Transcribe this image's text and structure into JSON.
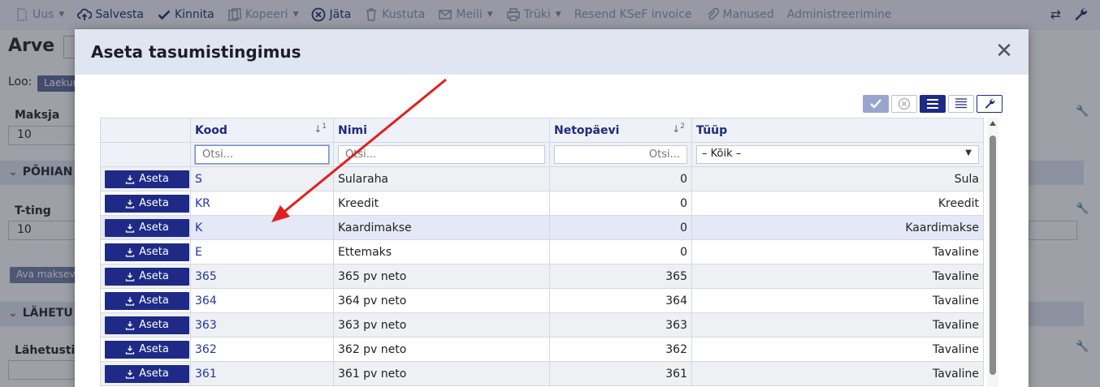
{
  "toolbar": {
    "items": [
      {
        "label": "Uus",
        "icon": "new-document-icon",
        "caret": true
      },
      {
        "label": "Salvesta",
        "icon": "cloud-upload-icon"
      },
      {
        "label": "Kinnita",
        "icon": "check-icon"
      },
      {
        "label": "Kopeeri",
        "icon": "copy-icon",
        "caret": true
      },
      {
        "label": "Jäta",
        "icon": "circle-x-icon"
      },
      {
        "label": "Kustuta",
        "icon": "trash-icon"
      },
      {
        "label": "Meili",
        "icon": "envelope-icon",
        "caret": true
      },
      {
        "label": "Trüki",
        "icon": "printer-icon",
        "caret": true
      },
      {
        "label": "Resend KSeF invoice"
      },
      {
        "label": "Manused",
        "icon": "paperclip-icon"
      },
      {
        "label": "Administreerimine"
      }
    ]
  },
  "page": {
    "title": "Arve",
    "loo_label": "Loo:",
    "loo_chip": "Laekum",
    "maksja_label": "Maksja",
    "maksja_value": "10",
    "section1": "PÕHIAN",
    "tting_label": "T-ting",
    "tting_value": "10",
    "ava_button": "Ava maksev",
    "section2": "LÄHETU",
    "lahetustin_label": "Lähetustin"
  },
  "modal": {
    "title": "Aseta tasumistingimus",
    "close_symbol": "✕",
    "columns": {
      "kood": "Kood",
      "kood_sort": "↓",
      "kood_sort_rank": "1",
      "nimi": "Nimi",
      "netopaevi": "Netopäevi",
      "netopaevi_sort": "↓",
      "netopaevi_sort_rank": "2",
      "tyyp": "Tüüp"
    },
    "filters": {
      "kood_placeholder": "Otsi...",
      "nimi_placeholder": "Otsi...",
      "netopaevi_placeholder": "Otsi...",
      "tyyp_selected": "– Kõik –"
    },
    "action_label": "Aseta",
    "rows": [
      {
        "kood": "S",
        "nimi": "Sularaha",
        "netopaevi": "0",
        "tyyp": "Sula"
      },
      {
        "kood": "KR",
        "nimi": "Kreedit",
        "netopaevi": "0",
        "tyyp": "Kreedit"
      },
      {
        "kood": "K",
        "nimi": "Kaardimakse",
        "netopaevi": "0",
        "tyyp": "Kaardimakse"
      },
      {
        "kood": "E",
        "nimi": "Ettemaks",
        "netopaevi": "0",
        "tyyp": "Tavaline"
      },
      {
        "kood": "365",
        "nimi": "365 pv neto",
        "netopaevi": "365",
        "tyyp": "Tavaline"
      },
      {
        "kood": "364",
        "nimi": "364 pv neto",
        "netopaevi": "364",
        "tyyp": "Tavaline"
      },
      {
        "kood": "363",
        "nimi": "363 pv neto",
        "netopaevi": "363",
        "tyyp": "Tavaline"
      },
      {
        "kood": "362",
        "nimi": "362 pv neto",
        "netopaevi": "362",
        "tyyp": "Tavaline"
      },
      {
        "kood": "361",
        "nimi": "361 pv neto",
        "netopaevi": "361",
        "tyyp": "Tavaline"
      }
    ],
    "highlighted_row": "K"
  },
  "colors": {
    "primary": "#1e2a86",
    "link": "#2335a6",
    "header_bg": "#dfe6f2",
    "annotation_arrow": "#e02020"
  }
}
